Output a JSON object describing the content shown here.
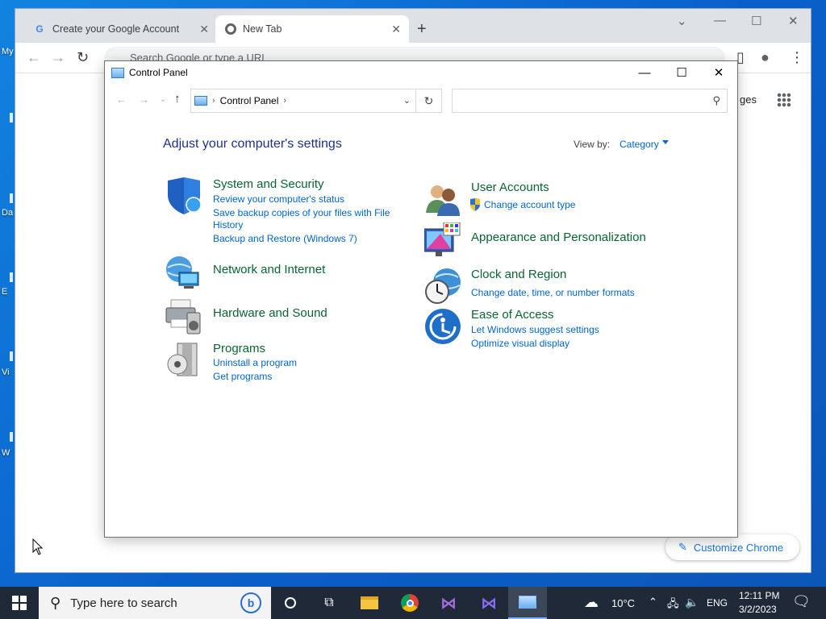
{
  "desktop": {
    "labels": [
      "My",
      "Da",
      "E",
      "Vi",
      "W"
    ]
  },
  "chrome": {
    "tabs": [
      {
        "label": "Create your Google Account",
        "favicon": "G"
      },
      {
        "label": "New Tab"
      }
    ],
    "omnibox_placeholder": "Search Google or type a URL",
    "ntp_images_partial": "ges",
    "customize_label": "Customize Chrome"
  },
  "control_panel": {
    "window_title": "Control Panel",
    "breadcrumb": "Control Panel",
    "heading": "Adjust your computer's settings",
    "view_by_label": "View by:",
    "view_by_value": "Category",
    "categories": [
      {
        "title": "System and Security",
        "links": [
          "Review your computer's status",
          "Save backup copies of your files with File",
          "History",
          "Backup and Restore (Windows 7)"
        ]
      },
      {
        "title": "Network and Internet",
        "links": []
      },
      {
        "title": "Hardware and Sound",
        "links": []
      },
      {
        "title": "Programs",
        "links": [
          "Uninstall a program",
          "Get programs"
        ]
      },
      {
        "title": "User Accounts",
        "links": [
          "Change account type"
        ]
      },
      {
        "title": "Appearance and Personalization",
        "links": []
      },
      {
        "title": "Clock and Region",
        "links": [
          "Change date, time, or number formats"
        ]
      },
      {
        "title": "Ease of Access",
        "links": [
          "Let Windows suggest settings",
          "Optimize visual display"
        ]
      }
    ]
  },
  "taskbar": {
    "search_placeholder": "Type here to search",
    "weather": "10°C",
    "language": "ENG",
    "time": "12:11 PM",
    "date": "3/2/2023"
  },
  "colors": {
    "link": "#0066cc",
    "category_title": "#0a6432",
    "heading": "#1e3287",
    "desktop": "#0a67d0",
    "taskbar": "#1f2937"
  }
}
